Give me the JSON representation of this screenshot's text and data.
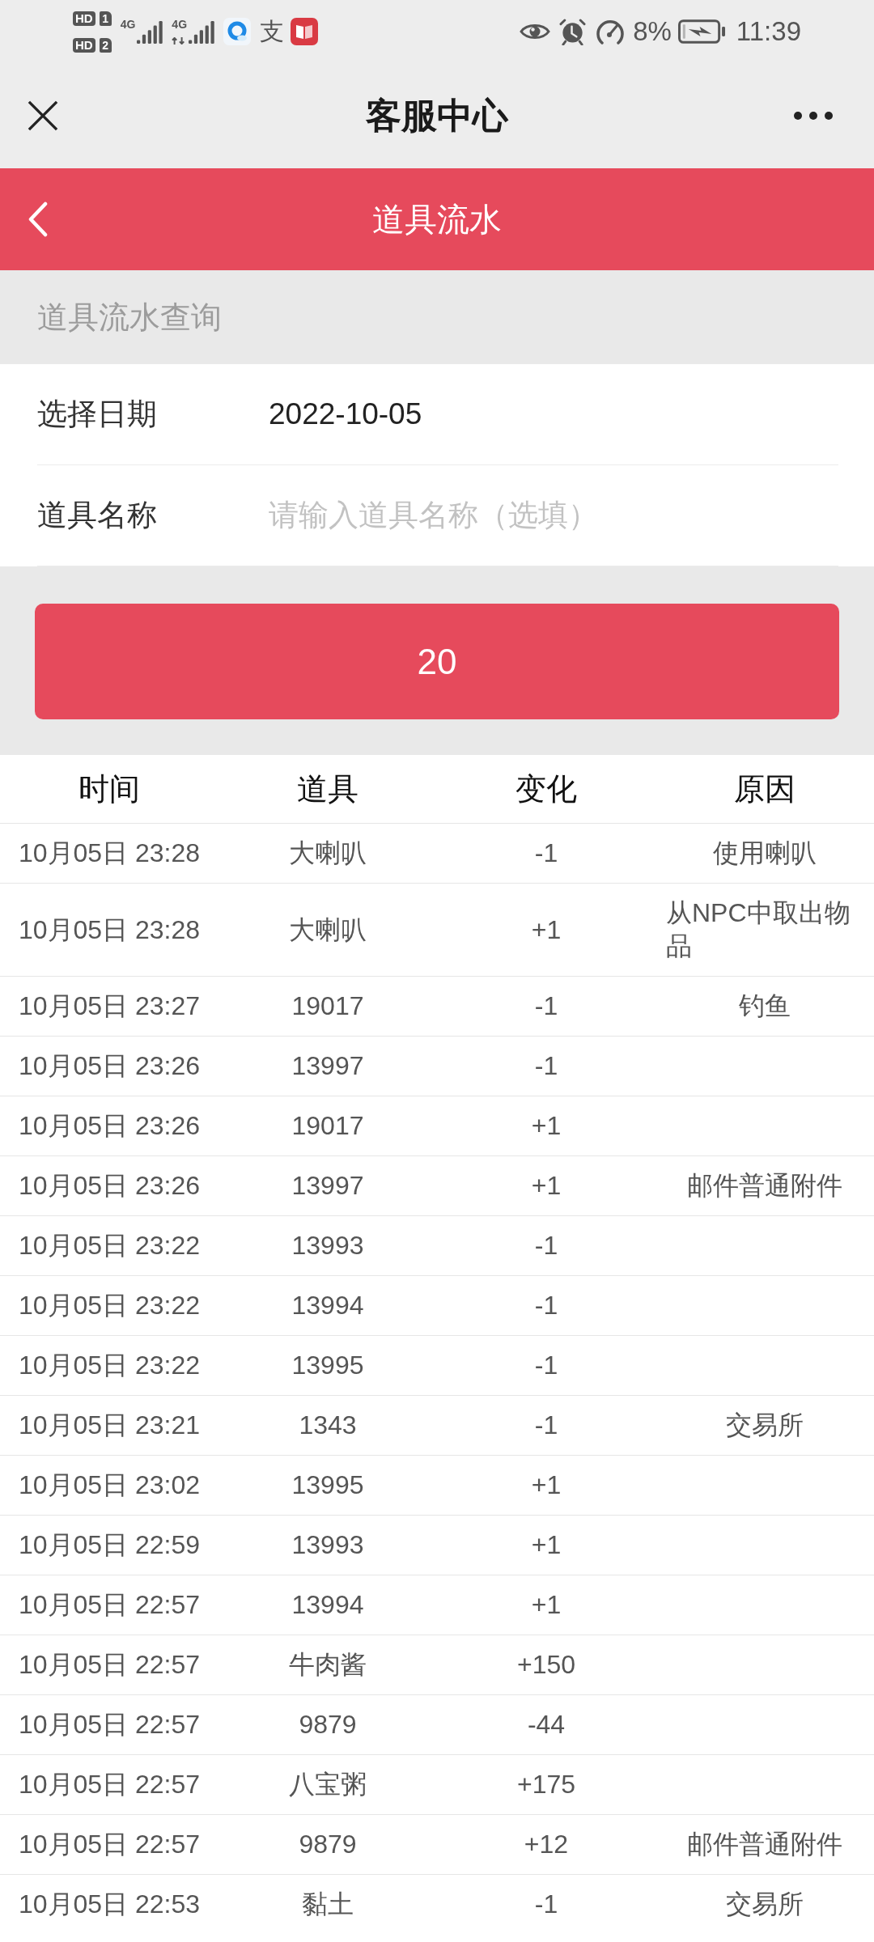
{
  "status_bar": {
    "sim_badges": [
      {
        "label": "HD",
        "slot": "1"
      },
      {
        "label": "HD",
        "slot": "2"
      }
    ],
    "networks": [
      {
        "type": "4G",
        "activity": false
      },
      {
        "type": "4G",
        "activity": true
      }
    ],
    "app_glyph": "支",
    "battery_percent": "8%",
    "time": "11:39"
  },
  "title_bar": {
    "title": "客服中心"
  },
  "page_header": {
    "title": "道具流水"
  },
  "section_label": "道具流水查询",
  "form": {
    "fields": [
      {
        "kind": "date",
        "label": "选择日期",
        "value": "2022-10-05"
      },
      {
        "kind": "text",
        "label": "道具名称",
        "placeholder": "请输入道具名称（选填）"
      }
    ]
  },
  "query_button": {
    "label": "20"
  },
  "table": {
    "columns": [
      "时间",
      "道具",
      "变化",
      "原因"
    ],
    "rows": [
      {
        "time": "10月05日 23:28",
        "item": "大喇叭",
        "change": "-1",
        "reason": "使用喇叭"
      },
      {
        "time": "10月05日 23:28",
        "item": "大喇叭",
        "change": "+1",
        "reason": "从NPC中取出物品"
      },
      {
        "time": "10月05日 23:27",
        "item": "19017",
        "change": "-1",
        "reason": "钓鱼"
      },
      {
        "time": "10月05日 23:26",
        "item": "13997",
        "change": "-1"
      },
      {
        "time": "10月05日 23:26",
        "item": "19017",
        "change": "+1"
      },
      {
        "time": "10月05日 23:26",
        "item": "13997",
        "change": "+1",
        "reason": "邮件普通附件"
      },
      {
        "time": "10月05日 23:22",
        "item": "13993",
        "change": "-1"
      },
      {
        "time": "10月05日 23:22",
        "item": "13994",
        "change": "-1"
      },
      {
        "time": "10月05日 23:22",
        "item": "13995",
        "change": "-1"
      },
      {
        "time": "10月05日 23:21",
        "item": "1343",
        "change": "-1",
        "reason": "交易所"
      },
      {
        "time": "10月05日 23:02",
        "item": "13995",
        "change": "+1"
      },
      {
        "time": "10月05日 22:59",
        "item": "13993",
        "change": "+1"
      },
      {
        "time": "10月05日 22:57",
        "item": "13994",
        "change": "+1"
      },
      {
        "time": "10月05日 22:57",
        "item": "牛肉酱",
        "change": "+150"
      },
      {
        "time": "10月05日 22:57",
        "item": "9879",
        "change": "-44"
      },
      {
        "time": "10月05日 22:57",
        "item": "八宝粥",
        "change": "+175"
      },
      {
        "time": "10月05日 22:57",
        "item": "9879",
        "change": "+12",
        "reason": "邮件普通附件"
      },
      {
        "time": "10月05日 22:53",
        "item": "黏土",
        "change": "-1",
        "reason": "交易所"
      }
    ]
  }
}
